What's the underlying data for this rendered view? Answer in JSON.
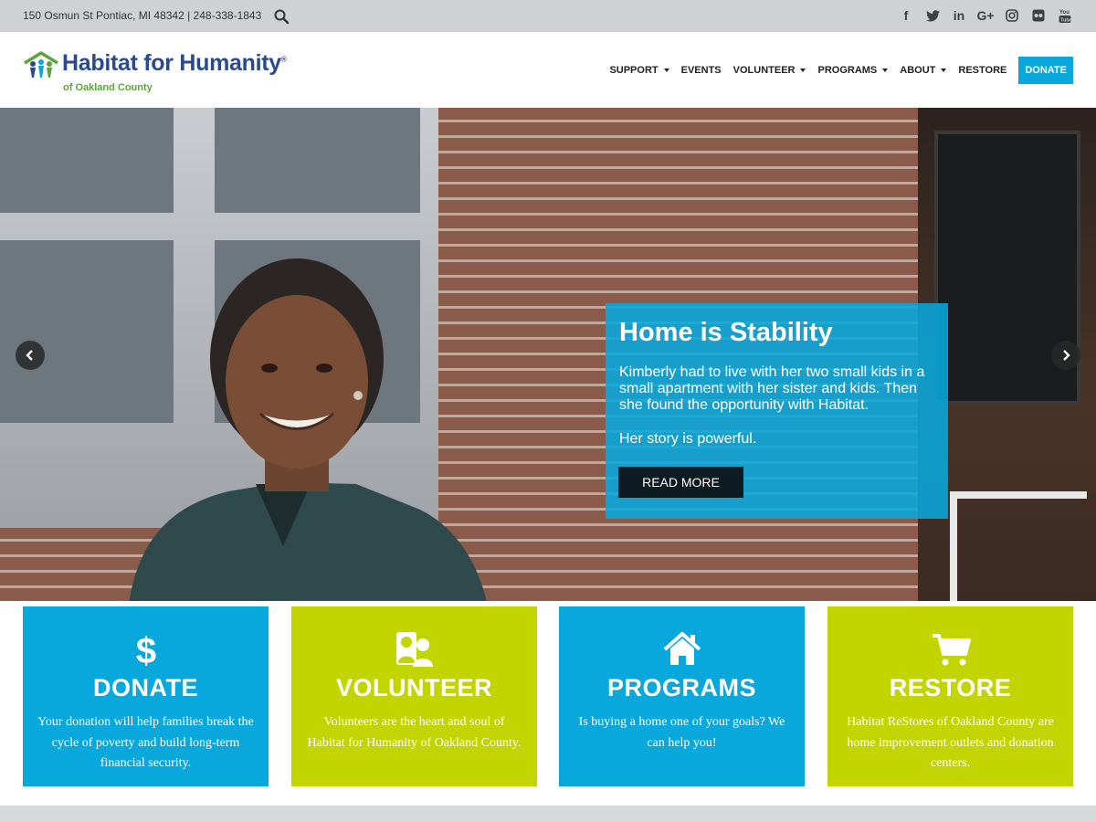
{
  "topbar": {
    "contact": "150 Osmun St Pontiac, MI 48342 | 248-338-1843",
    "socials": [
      {
        "icon": "facebook-icon",
        "glyph": "f"
      },
      {
        "icon": "twitter-icon",
        "glyph": "t"
      },
      {
        "icon": "linkedin-icon",
        "glyph": "in"
      },
      {
        "icon": "google-plus-icon",
        "glyph": "G+"
      },
      {
        "icon": "instagram-icon",
        "glyph": "◎"
      },
      {
        "icon": "flickr-icon",
        "glyph": "●●"
      },
      {
        "icon": "youtube-icon",
        "glyph": "▶"
      }
    ]
  },
  "logo": {
    "name": "Habitat for Humanity",
    "registered": "®",
    "subtitle": "of Oakland County"
  },
  "nav": {
    "items": [
      {
        "label": "SUPPORT",
        "dropdown": true
      },
      {
        "label": "EVENTS",
        "dropdown": false
      },
      {
        "label": "VOLUNTEER",
        "dropdown": true
      },
      {
        "label": "PROGRAMS",
        "dropdown": true
      },
      {
        "label": "ABOUT",
        "dropdown": true
      },
      {
        "label": "RESTORE",
        "dropdown": false
      }
    ],
    "donate": "DONATE"
  },
  "hero": {
    "title": "Home is Stability",
    "body": "Kimberly had to live with her two small kids in a small apartment with her sister and kids. Then she found the opportunity with Habitat.",
    "tagline": "Her story is powerful.",
    "button": "READ MORE"
  },
  "cards": [
    {
      "title": "DONATE",
      "desc": "Your donation will help families break the cycle of poverty and build long-term financial security.",
      "icon": "dollar-icon",
      "color": "#08a7dc"
    },
    {
      "title": "VOLUNTEER",
      "desc": "Volunteers are the heart and soul of Habitat for Humanity of Oakland County.",
      "icon": "people-icon",
      "color": "#c2d500"
    },
    {
      "title": "PROGRAMS",
      "desc": "Is buying a home one of your goals? We can help you!",
      "icon": "home-icon",
      "color": "#08a7dc"
    },
    {
      "title": "RESTORE",
      "desc": "Habitat ReStores of Oakland County are home improvement outlets and donation centers.",
      "icon": "cart-icon",
      "color": "#c2d500"
    }
  ],
  "colors": {
    "brand_blue": "#2a4a8e",
    "brand_green": "#5ea33a",
    "accent_cyan": "#08a7dc",
    "accent_lime": "#c2d500"
  }
}
